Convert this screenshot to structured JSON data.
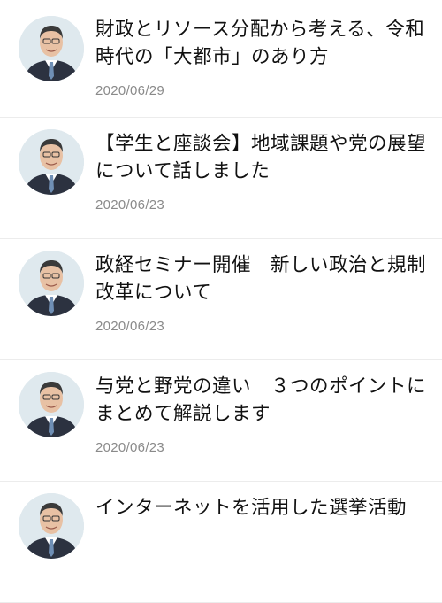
{
  "posts": [
    {
      "title": "財政とリソース分配から考える、令和時代の「大都市」のあり方",
      "date": "2020/06/29"
    },
    {
      "title": "【学生と座談会】地域課題や党の展望について話しました",
      "date": "2020/06/23"
    },
    {
      "title": "政経セミナー開催　新しい政治と規制改革について",
      "date": "2020/06/23"
    },
    {
      "title": "与党と野党の違い　３つのポイントにまとめて解説します",
      "date": "2020/06/23"
    },
    {
      "title": "インターネットを活用した選挙活動",
      "date": ""
    }
  ],
  "colors": {
    "date": "#8a8a8a",
    "divider": "#ececec",
    "avatar_bg": "#dfe9ee",
    "suit": "#2c3240",
    "tie": "#6f8fb5"
  }
}
